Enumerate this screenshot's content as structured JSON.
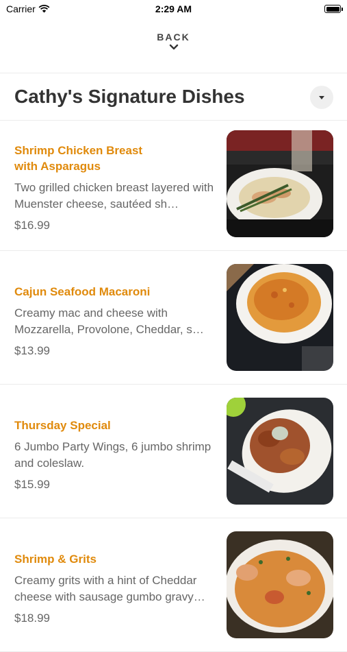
{
  "status_bar": {
    "carrier": "Carrier",
    "time": "2:29 AM"
  },
  "nav": {
    "back_label": "BACK"
  },
  "section": {
    "title": "Cathy's Signature Dishes"
  },
  "items": [
    {
      "name": "Shrimp Chicken Breast with Asparagus",
      "description": "Two grilled chicken breast layered with Muenster cheese, sautéed sh…",
      "price": "$16.99",
      "photo_icon": "plated-chicken-photo"
    },
    {
      "name": "Cajun Seafood Macaroni",
      "description": "Creamy mac and cheese with Mozzarella, Provolone, Cheddar, s…",
      "price": "$13.99",
      "photo_icon": "macaroni-photo"
    },
    {
      "name": "Thursday Special",
      "description": "6 Jumbo Party Wings, 6 jumbo shrimp and coleslaw.",
      "price": "$15.99",
      "photo_icon": "wings-photo"
    },
    {
      "name": "Shrimp & Grits",
      "description": "Creamy grits with a hint of Cheddar cheese with sausage gumbo gravy…",
      "price": "$18.99",
      "photo_icon": "shrimp-grits-photo"
    }
  ],
  "colors": {
    "accent": "#e08a0c",
    "text": "#333333",
    "muted": "#666666"
  }
}
